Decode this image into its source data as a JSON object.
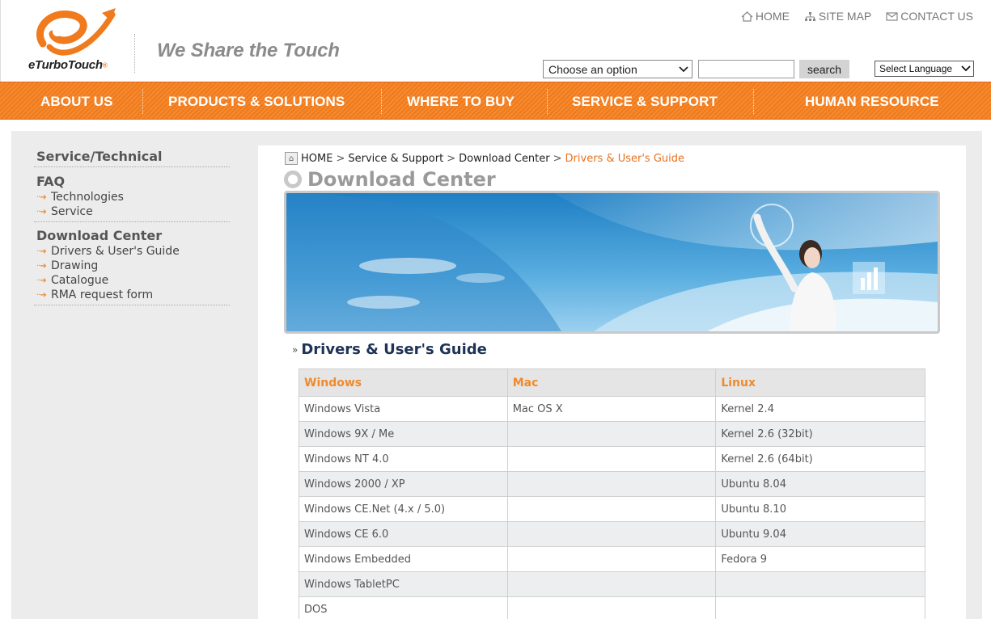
{
  "brand": {
    "logo_text": "eTurboTouch",
    "tagline": "We Share the Touch"
  },
  "top_links": {
    "home": "HOME",
    "site_map": "SITE MAP",
    "contact_us": "CONTACT US"
  },
  "search": {
    "select_value": "Choose an option",
    "input_value": "",
    "button_label": "search"
  },
  "language": {
    "select_value": "Select Language"
  },
  "nav": {
    "items": [
      {
        "label": "ABOUT US"
      },
      {
        "label": "PRODUCTS & SOLUTIONS"
      },
      {
        "label": "WHERE TO BUY"
      },
      {
        "label": "SERVICE & SUPPORT"
      },
      {
        "label": "HUMAN RESOURCE"
      }
    ]
  },
  "sidebar": {
    "title": "Service/Technical",
    "faq": {
      "heading": "FAQ",
      "items": [
        "Technologies",
        "Service"
      ]
    },
    "download": {
      "heading": "Download Center",
      "items": [
        "Drivers & User's Guide",
        "Drawing",
        "Catalogue",
        "RMA request form"
      ]
    }
  },
  "breadcrumb": {
    "items": [
      "HOME",
      "Service & Support",
      "Download Center"
    ],
    "current": "Drivers & User's Guide",
    "separator": ">"
  },
  "page_title": "Download Center",
  "section_title": "Drivers & User's Guide",
  "table": {
    "headers": [
      "Windows",
      "Mac",
      "Linux"
    ],
    "rows": [
      [
        "Windows Vista",
        "Mac OS X",
        "Kernel 2.4"
      ],
      [
        "Windows 9X / Me",
        "",
        "Kernel 2.6 (32bit)"
      ],
      [
        "Windows NT 4.0",
        "",
        "Kernel 2.6 (64bit)"
      ],
      [
        "Windows 2000 / XP",
        "",
        "Ubuntu 8.04"
      ],
      [
        "Windows CE.Net (4.x / 5.0)",
        "",
        "Ubuntu 8.10"
      ],
      [
        "Windows CE 6.0",
        "",
        "Ubuntu 9.04"
      ],
      [
        "Windows Embedded",
        "",
        "Fedora 9"
      ],
      [
        "Windows TabletPC",
        "",
        ""
      ],
      [
        "DOS",
        "",
        ""
      ]
    ]
  },
  "colors": {
    "accent_orange": "#f08a2c",
    "nav_orange": "#f07a1e",
    "title_navy": "#1e3355"
  }
}
